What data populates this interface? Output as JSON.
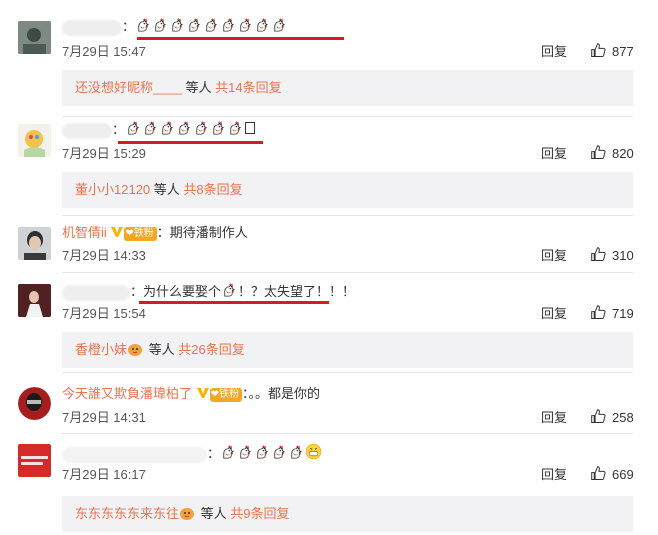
{
  "comments": [
    {
      "username": "",
      "text": "",
      "emoji_count": 9,
      "time": "7月29日 15:47",
      "reply_label": "回复",
      "likes": "877",
      "sub": {
        "name": "还没想好昵称____",
        "middle": " 等人 ",
        "count": "共14条回复"
      }
    },
    {
      "username": "",
      "text": "",
      "emoji_count": 7,
      "time": "7月29日 15:29",
      "reply_label": "回复",
      "likes": "820",
      "sub": {
        "name": "董小小12120",
        "middle": " 等人 ",
        "count": "共8条回复"
      }
    },
    {
      "username": "机智倩ii",
      "badge": "铁粉",
      "text": "：期待潘制作人",
      "time": "7月29日 14:33",
      "reply_label": "回复",
      "likes": "310"
    },
    {
      "username": "",
      "text_before": "：为什么要娶个",
      "text_after": "！？太失望了！！！",
      "time": "7月29日 15:54",
      "reply_label": "回复",
      "likes": "719",
      "sub": {
        "name": "香橙小妹",
        "middle": " 等人 ",
        "count": "共26条回复"
      }
    },
    {
      "username": "今天誰又欺負潘瑋柏了",
      "badge": "铁粉",
      "text": "：。。都是你的",
      "time": "7月29日 14:31",
      "reply_label": "回复",
      "likes": "258"
    },
    {
      "username": "",
      "text": "",
      "emoji_count": 5,
      "time": "7月29日 16:17",
      "reply_label": "回复",
      "likes": "669",
      "sub": {
        "name": "东东东东东来东往",
        "middle": " 等人 ",
        "count": "共9条回复"
      }
    }
  ],
  "colors": {
    "username": "#eb7350",
    "underline": "#d61d1d",
    "subbox": "#f2f2f5"
  }
}
